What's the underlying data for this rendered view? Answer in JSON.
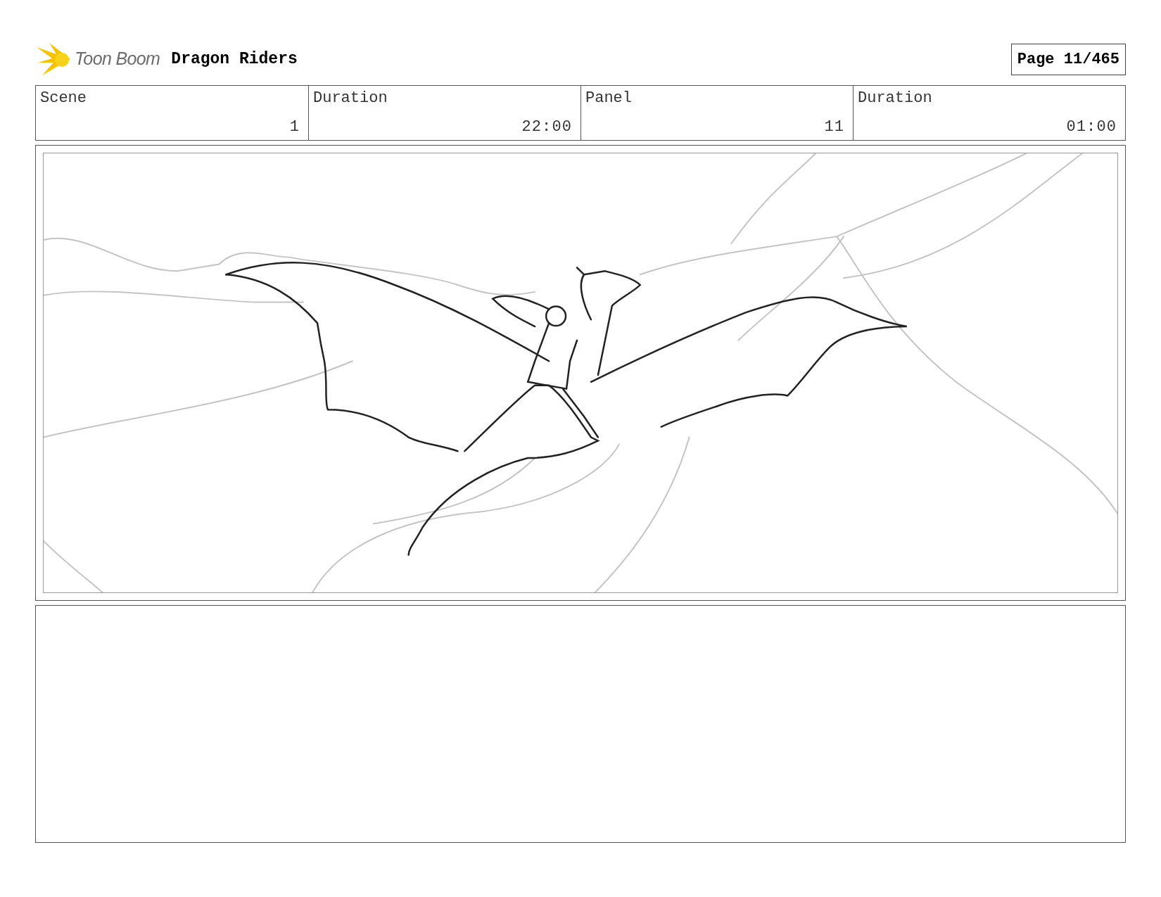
{
  "header": {
    "logo_text": "Toon Boom",
    "project_title": "Dragon Riders",
    "page_label": "Page",
    "page_number": "11/465"
  },
  "info": [
    {
      "label": "Scene",
      "value": "1"
    },
    {
      "label": "Duration",
      "value": "22:00"
    },
    {
      "label": "Panel",
      "value": "11"
    },
    {
      "label": "Duration",
      "value": "01:00"
    }
  ]
}
